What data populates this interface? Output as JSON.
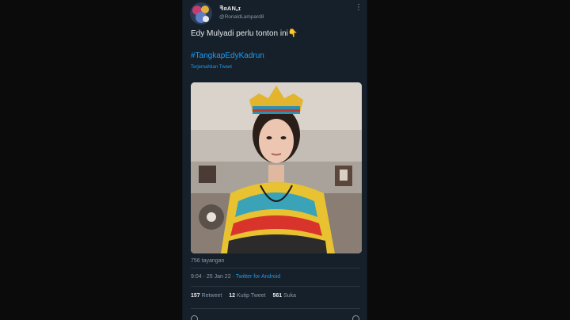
{
  "tweet": {
    "display_name": "ꟻᴙAN꜀ɪ",
    "handle": "@RonaldLampard8",
    "text": "Edy Mulyadi perlu tonton ini👇",
    "hashtag": "#TangkapEdyKadrun",
    "translate_label": "Terjemahkan Tweet",
    "views": "756 tayangan",
    "time": "9:04 · 25 Jan 22 ·",
    "source": "Twitter for Android",
    "stats": {
      "retweets_count": "157",
      "retweets_label": "Retweet",
      "quotes_count": "12",
      "quotes_label": "Kutip Tweet",
      "likes_count": "561",
      "likes_label": "Suka"
    }
  },
  "colors": {
    "background": "#15202b",
    "text": "#e7e9ea",
    "secondary": "#8b98a5",
    "accent": "#1d9bf0"
  },
  "icons": {
    "more": "more-options-icon"
  }
}
